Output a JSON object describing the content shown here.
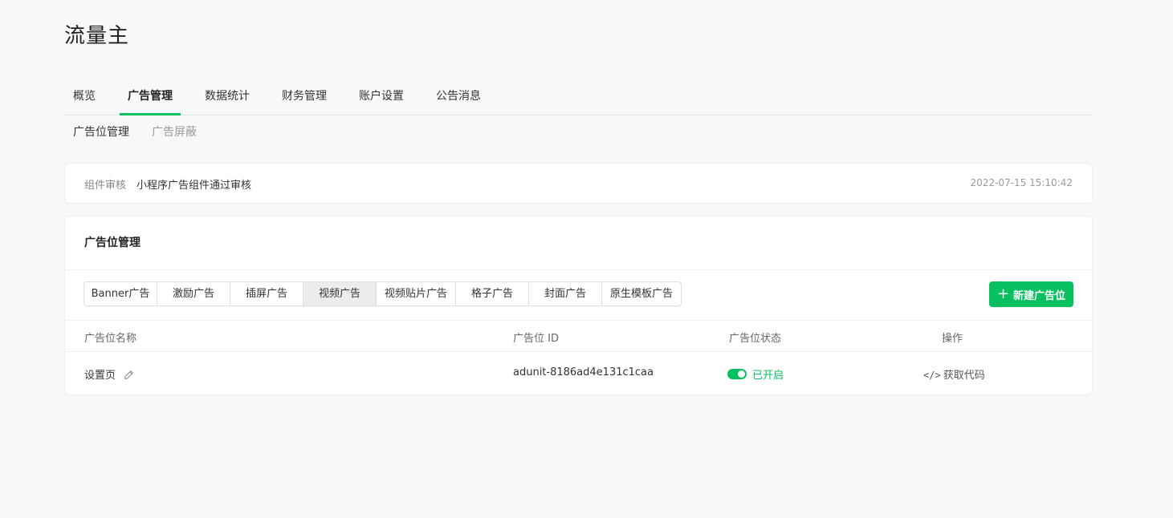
{
  "app": {
    "title": "流量主"
  },
  "main_tabs": [
    {
      "label": "概览",
      "active": false
    },
    {
      "label": "广告管理",
      "active": true
    },
    {
      "label": "数据统计",
      "active": false
    },
    {
      "label": "财务管理",
      "active": false
    },
    {
      "label": "账户设置",
      "active": false
    },
    {
      "label": "公告消息",
      "active": false
    }
  ],
  "sub_tabs": [
    {
      "label": "广告位管理",
      "active": true
    },
    {
      "label": "广告屏蔽",
      "active": false
    }
  ],
  "audit": {
    "label": "组件审核",
    "text": "小程序广告组件通过审核",
    "time": "2022-07-15 15:10:42"
  },
  "ad_panel": {
    "title": "广告位管理",
    "ad_types": [
      {
        "label": "Banner广告",
        "active": false
      },
      {
        "label": "激励广告",
        "active": false
      },
      {
        "label": "插屏广告",
        "active": false
      },
      {
        "label": "视频广告",
        "active": true
      },
      {
        "label": "视频贴片广告",
        "active": false
      },
      {
        "label": "格子广告",
        "active": false
      },
      {
        "label": "封面广告",
        "active": false
      },
      {
        "label": "原生模板广告",
        "active": false
      }
    ],
    "new_button": {
      "label": "新建广告位",
      "icon": "plus-icon"
    },
    "table": {
      "headers": {
        "name": "广告位名称",
        "id": "广告位 ID",
        "status": "广告位状态",
        "action": "操作"
      },
      "rows": [
        {
          "name": "设置页",
          "id": "adunit-8186ad4e131c1caa",
          "status": "已开启",
          "enabled": true,
          "action_icon": "</>",
          "action": "获取代码"
        }
      ]
    }
  },
  "colors": {
    "accent": "#07c160",
    "background": "#f7f8fa",
    "muted": "#9a9a9a"
  }
}
